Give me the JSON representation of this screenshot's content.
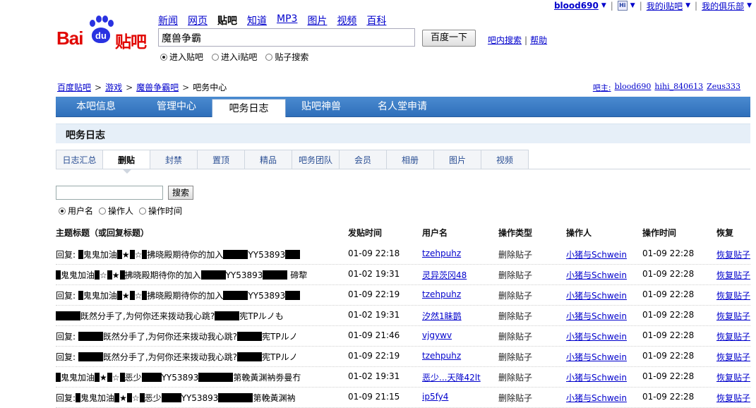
{
  "userbar": {
    "username": "blood690",
    "hi_icon": "hi-icon",
    "my_ibar": "我的i贴吧",
    "my_club": "我的俱乐部"
  },
  "logo": {
    "brand_bai": "Bai",
    "brand_du": "du",
    "brand_tieba": "贴吧"
  },
  "prodnav": [
    "新闻",
    "网页",
    "贴吧",
    "知道",
    "MP3",
    "图片",
    "视频",
    "百科"
  ],
  "search": {
    "value": "魔兽争霸",
    "button": "百度一下",
    "inbar": "吧内搜索",
    "help": "帮助"
  },
  "search_modes": [
    "进入贴吧",
    "进入i贴吧",
    "贴子搜索"
  ],
  "breadcrumb": [
    "百度贴吧",
    "游戏",
    "魔兽争霸吧",
    "吧务中心"
  ],
  "admins": {
    "label": "吧主:",
    "names": [
      "blood690",
      "hihi_840613",
      "Zeus333"
    ]
  },
  "mainnav": [
    "本吧信息",
    "管理中心",
    "吧务日志",
    "贴吧神兽",
    "名人堂申请"
  ],
  "section_title": "吧务日志",
  "subtabs": [
    "日志汇总",
    "删贴",
    "封禁",
    "置顶",
    "精品",
    "吧务团队",
    "会员",
    "相册",
    "图片",
    "视频"
  ],
  "log_search": {
    "button": "搜索",
    "modes": [
      "用户名",
      "操作人",
      "操作时间"
    ]
  },
  "table": {
    "headers": [
      "主题标题（或回复标题）",
      "发贴时间",
      "用户名",
      "操作类型",
      "操作人",
      "操作时间",
      "恢复"
    ],
    "rows": [
      {
        "title": [
          "回复: ",
          "▇",
          "鬼鬼加油",
          "▇",
          "★",
          "▇",
          "☆",
          "▇",
          "拂晓殿期待你的加入",
          "▇▇▇▇▇",
          "YY53893",
          "▇▇▇"
        ],
        "post_time": "01-09 22:18",
        "user": "tzehpuhz",
        "op_type": "删除贴子",
        "operator": "小猪与Schwein",
        "op_time": "01-09 22:28",
        "restore": "恢复贴子"
      },
      {
        "title": [
          "▇",
          "鬼鬼加油",
          "▇",
          "☆",
          "▇",
          "★",
          "▇",
          "拂晓殿期待你的加入",
          "▇▇▇▇▇",
          "YY53893",
          "▇▇▇▇▇",
          " 碲犂"
        ],
        "post_time": "01-02 19:31",
        "user": "灵异茨冈48",
        "op_type": "删除贴子",
        "operator": "小猪与Schwein",
        "op_time": "01-09 22:28",
        "restore": "恢复贴子"
      },
      {
        "title": [
          "回复: ",
          "▇",
          "鬼鬼加油",
          "▇",
          "★",
          "▇",
          "☆",
          "▇",
          "拂晓殿期待你的加入",
          "▇▇▇▇▇",
          "YY53893",
          "▇▇▇"
        ],
        "post_time": "01-09 22:19",
        "user": "tzehpuhz",
        "op_type": "删除贴子",
        "operator": "小猪与Schwein",
        "op_time": "01-09 22:28",
        "restore": "恢复贴子"
      },
      {
        "title": [
          "▇▇▇▇▇",
          "既然分手了,为何你还来拨动我心跳?",
          "▇▇▇▇▇",
          "宪TPルノも"
        ],
        "post_time": "01-02 19:31",
        "user": "汐然1眛鹊",
        "op_type": "删除贴子",
        "operator": "小猪与Schwein",
        "op_time": "01-09 22:28",
        "restore": "恢复贴子"
      },
      {
        "title": [
          "回复: ",
          "▇▇▇▇▇",
          "既然分手了,为何你还来拨动我心跳?",
          "▇▇▇▇▇",
          "宪TPルノ"
        ],
        "post_time": "01-09 21:46",
        "user": "vjgywv",
        "op_type": "删除贴子",
        "operator": "小猪与Schwein",
        "op_time": "01-09 22:28",
        "restore": "恢复贴子"
      },
      {
        "title": [
          "回复: ",
          "▇▇▇▇▇",
          "既然分手了,为何你还来拨动我心跳?",
          "▇▇▇▇▇",
          "宪TPルノ"
        ],
        "post_time": "01-09 22:19",
        "user": "tzehpuhz",
        "op_type": "删除贴子",
        "operator": "小猪与Schwein",
        "op_time": "01-09 22:28",
        "restore": "恢复贴子"
      },
      {
        "title": [
          "▇",
          "鬼鬼加油",
          "▇",
          "★",
          "▇",
          "☆",
          "▇",
          "恶少",
          "▇▇▇▇",
          "YY53893",
          "▇▇▇▇▇▇▇",
          "第輓黃渊衲劵曼冇"
        ],
        "post_time": "01-02 19:31",
        "user": "恶少...天降42lt",
        "op_type": "删除贴子",
        "operator": "小猪与Schwein",
        "op_time": "01-09 22:28",
        "restore": "恢复贴子"
      },
      {
        "title": [
          "回复:",
          "▇",
          "鬼鬼加油",
          "▇",
          "★",
          "▇",
          "☆",
          "▇",
          "恶少",
          "▇▇▇▇",
          "YY53893",
          "▇▇▇▇▇▇▇",
          "第輓黃渊衲"
        ],
        "post_time": "01-09 21:15",
        "user": "ip5fy4",
        "op_type": "删除贴子",
        "operator": "小猪与Schwein",
        "op_time": "01-09 22:28",
        "restore": "恢复贴子"
      }
    ]
  }
}
